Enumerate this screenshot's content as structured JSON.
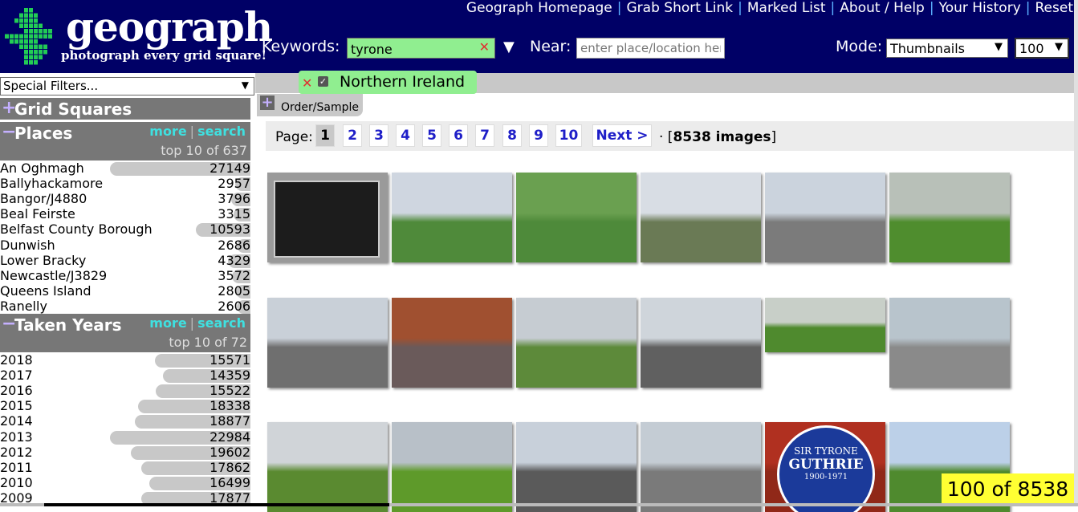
{
  "header": {
    "logo_text": "geograph",
    "tagline": "photograph every grid square!",
    "nav_links": [
      "Geograph Homepage",
      "Grab Short Link",
      "Marked List",
      "About / Help",
      "Your History",
      "Reset"
    ],
    "keywords_label": "Keywords:",
    "keywords_value": "tyrone",
    "near_label": "Near:",
    "near_placeholder": "enter place/location here",
    "mode_label": "Mode:",
    "mode_value": "Thumbnails",
    "per_page_value": "100"
  },
  "active_filter": {
    "label": "Northern Ireland"
  },
  "order_tab_label": "Order/Sample",
  "sidebar": {
    "special_filters": "Special Filters...",
    "grid_squares_title": "Grid Squares",
    "places": {
      "title": "Places",
      "more": "more",
      "search": "search",
      "subtitle": "top 10 of 637",
      "items": [
        {
          "label": "An Oghmagh",
          "count": "27149",
          "value": 27149
        },
        {
          "label": "Ballyhackamore",
          "count": "2957",
          "value": 2957
        },
        {
          "label": "Bangor/J4880",
          "count": "3796",
          "value": 3796
        },
        {
          "label": "Beal Feirste",
          "count": "3315",
          "value": 3315
        },
        {
          "label": "Belfast County Borough",
          "count": "10593",
          "value": 10593
        },
        {
          "label": "Dunwish",
          "count": "2686",
          "value": 2686
        },
        {
          "label": "Lower Bracky",
          "count": "4329",
          "value": 4329
        },
        {
          "label": "Newcastle/J3829",
          "count": "3572",
          "value": 3572
        },
        {
          "label": "Queens Island",
          "count": "2805",
          "value": 2805
        },
        {
          "label": "Ranelly",
          "count": "2606",
          "value": 2606
        }
      ]
    },
    "years": {
      "title": "Taken Years",
      "more": "more",
      "search": "search",
      "subtitle": "top 10 of 72",
      "items": [
        {
          "label": "2018",
          "count": "15571",
          "value": 15571
        },
        {
          "label": "2017",
          "count": "14359",
          "value": 14359
        },
        {
          "label": "2016",
          "count": "15522",
          "value": 15522
        },
        {
          "label": "2015",
          "count": "18338",
          "value": 18338
        },
        {
          "label": "2014",
          "count": "18877",
          "value": 18877
        },
        {
          "label": "2013",
          "count": "22984",
          "value": 22984
        },
        {
          "label": "2012",
          "count": "19602",
          "value": 19602
        },
        {
          "label": "2011",
          "count": "17862",
          "value": 17862
        },
        {
          "label": "2010",
          "count": "16499",
          "value": 16499
        },
        {
          "label": "2009",
          "count": "17877",
          "value": 17877
        }
      ]
    }
  },
  "pager": {
    "label": "Page:",
    "pages": [
      "1",
      "2",
      "3",
      "4",
      "5",
      "6",
      "7",
      "8",
      "9",
      "10"
    ],
    "current": "1",
    "next": "Next >",
    "dot": "·",
    "total": "[8538 images]",
    "total_bold": "8538 images"
  },
  "counter": "100 of 8538",
  "thumbnails": [
    {
      "scene": "plaque",
      "sky": "#8a8a8a",
      "ground": "#2a2a2a"
    },
    {
      "scene": "church-hall",
      "sky": "#cfd6e0",
      "ground": "#4f8a3a"
    },
    {
      "scene": "aerial",
      "sky": "#6aa050",
      "ground": "#4e8a3a"
    },
    {
      "scene": "church-spire",
      "sky": "#d8dde4",
      "ground": "#6a7a55"
    },
    {
      "scene": "street",
      "sky": "#cbd3dd",
      "ground": "#7b7b7b"
    },
    {
      "scene": "field-sign",
      "sky": "#b8c0b8",
      "ground": "#4f8d2e"
    },
    {
      "scene": "brick-building",
      "sky": "#c9d0d8",
      "ground": "#6f6f6f"
    },
    {
      "scene": "crowd",
      "sky": "#a05030",
      "ground": "#6a5a5a"
    },
    {
      "scene": "field",
      "sky": "#c6ccd2",
      "ground": "#5d8a3a"
    },
    {
      "scene": "road",
      "sky": "#cfd5db",
      "ground": "#606060"
    },
    {
      "scene": "wall-field",
      "sky": "#c8cfc8",
      "ground": "#4f8a2e"
    },
    {
      "scene": "shop-front",
      "sky": "#b8c4cc",
      "ground": "#8a8a8a"
    },
    {
      "scene": "field",
      "sky": "#d0d4d8",
      "ground": "#5a8a30"
    },
    {
      "scene": "green-field",
      "sky": "#b8c0c8",
      "ground": "#5e9a2a"
    },
    {
      "scene": "modern-building",
      "sky": "#c8d0da",
      "ground": "#5a5a5a"
    },
    {
      "scene": "street-corner",
      "sky": "#c4ccd4",
      "ground": "#7a7a7a"
    },
    {
      "scene": "blue-plaque",
      "sky": "#b03020",
      "ground": "#902818"
    },
    {
      "scene": "houses",
      "sky": "#bcd0e8",
      "ground": "#4f8a2e"
    }
  ],
  "plaque_text": {
    "title": "SIR TYRONE",
    "name": "GUTHRIE",
    "dates": "1900-1971"
  },
  "colors": {
    "header_bg": "#000066",
    "keyword_bg": "#90ee90",
    "link_blue": "#1f1fc8",
    "accent_cyan": "#3fe0e0",
    "counter_bg": "#ffff33"
  }
}
